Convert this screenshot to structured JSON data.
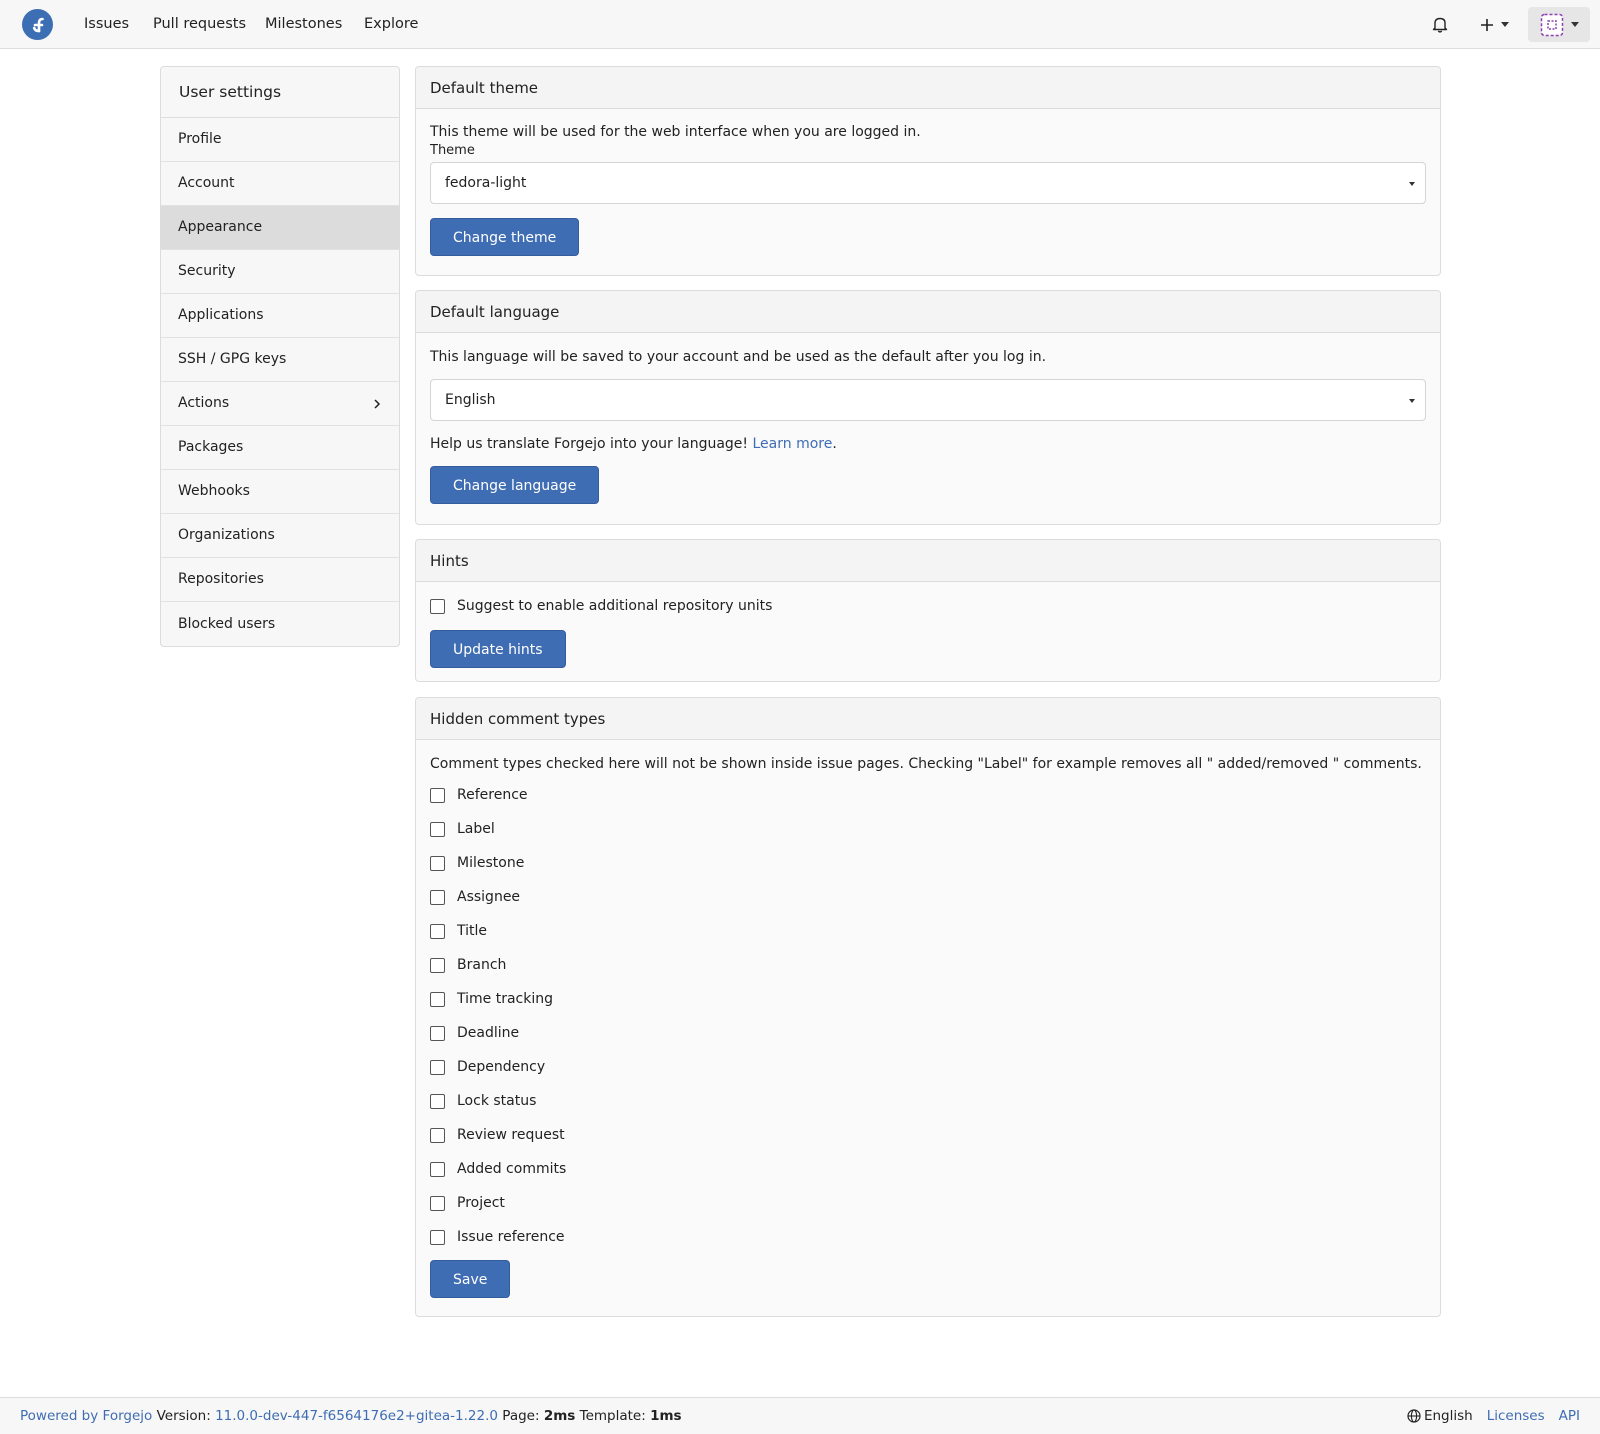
{
  "nav": {
    "links": [
      "Issues",
      "Pull requests",
      "Milestones",
      "Explore"
    ],
    "icons": {
      "logo": "fedora-logo",
      "notifications": "bell-icon",
      "create": "plus-icon",
      "user": "avatar-icon"
    }
  },
  "sidebar": {
    "header": "User settings",
    "items": [
      {
        "label": "Profile"
      },
      {
        "label": "Account"
      },
      {
        "label": "Appearance",
        "active": true
      },
      {
        "label": "Security"
      },
      {
        "label": "Applications"
      },
      {
        "label": "SSH / GPG keys"
      },
      {
        "label": "Actions",
        "chevron": true
      },
      {
        "label": "Packages"
      },
      {
        "label": "Webhooks"
      },
      {
        "label": "Organizations"
      },
      {
        "label": "Repositories"
      },
      {
        "label": "Blocked users"
      }
    ]
  },
  "theme": {
    "title": "Default theme",
    "description": "This theme will be used for the web interface when you are logged in.",
    "field_label": "Theme",
    "selected": "fedora-light",
    "button": "Change theme"
  },
  "language": {
    "title": "Default language",
    "description": "This language will be saved to your account and be used as the default after you log in.",
    "selected": "English",
    "help_text": "Help us translate Forgejo into your language!",
    "learn_more": "Learn more",
    "learn_more_suffix": ".",
    "button": "Change language"
  },
  "hints": {
    "title": "Hints",
    "checkbox_label": "Suggest to enable additional repository units",
    "checked": false,
    "button": "Update hints"
  },
  "hidden_comments": {
    "title": "Hidden comment types",
    "description": "Comment types checked here will not be shown inside issue pages. Checking \"Label\" for example removes all \" added/removed \" comments.",
    "types": [
      "Reference",
      "Label",
      "Milestone",
      "Assignee",
      "Title",
      "Branch",
      "Time tracking",
      "Deadline",
      "Dependency",
      "Lock status",
      "Review request",
      "Added commits",
      "Project",
      "Issue reference"
    ],
    "button": "Save"
  },
  "footer": {
    "powered_by": "Powered by Forgejo",
    "version_label": "Version:",
    "version": "11.0.0-dev-447-f6564176e2+gitea-1.22.0",
    "page_label": "Page:",
    "page_time": "2ms",
    "template_label": "Template:",
    "template_time": "1ms",
    "language": "English",
    "licenses": "Licenses",
    "api": "API"
  },
  "colors": {
    "accent": "#3f6db3",
    "logo": "#3c6eb4",
    "active_sidebar": "#dcdcdc"
  }
}
